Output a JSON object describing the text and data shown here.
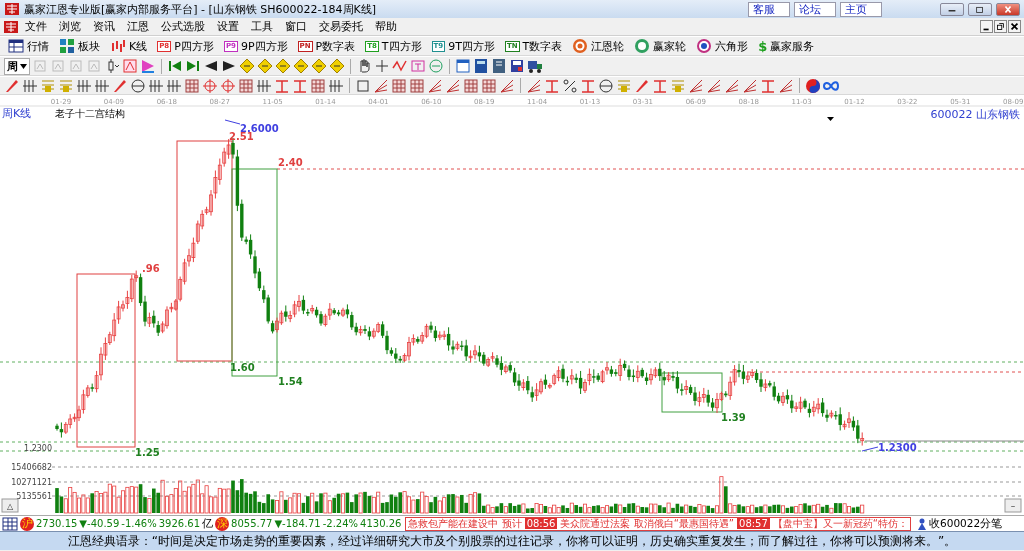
{
  "window": {
    "title": "赢家江恩专业版[赢家内部服务平台] - [山东钢铁  SH600022-184周K线]",
    "links": [
      "客服",
      "论坛",
      "主页"
    ]
  },
  "menu": [
    "文件",
    "浏览",
    "资讯",
    "江恩",
    "公式选股",
    "设置",
    "工具",
    "窗口",
    "交易委托",
    "帮助"
  ],
  "toolbar": [
    {
      "label": "行情",
      "kind": "table"
    },
    {
      "label": "板块",
      "kind": "blocks"
    },
    {
      "label": "K线",
      "kind": "kline"
    },
    {
      "label": "P四方形",
      "kind": "badge",
      "badge": "P8",
      "color": "#e03030"
    },
    {
      "label": "9P四方形",
      "kind": "badge",
      "badge": "P9",
      "color": "#c030c0"
    },
    {
      "label": "P数字表",
      "kind": "badge",
      "badge": "PN",
      "color": "#c02020"
    },
    {
      "label": "T四方形",
      "kind": "badge",
      "badge": "T8",
      "color": "#20a020"
    },
    {
      "label": "9T四方形",
      "kind": "badge",
      "badge": "T9",
      "color": "#209090"
    },
    {
      "label": "T数字表",
      "kind": "badge",
      "badge": "TN",
      "color": "#208020"
    },
    {
      "label": "江恩轮",
      "kind": "wheel"
    },
    {
      "label": "赢家轮",
      "kind": "wheel2"
    },
    {
      "label": "六角形",
      "kind": "hexagon"
    },
    {
      "label": "赢家服务",
      "kind": "glyph",
      "badge": "$"
    }
  ],
  "period_selector": {
    "value": "周"
  },
  "chart": {
    "period": "周K线",
    "indicator": "老子十二宫结构",
    "stock": "600022 山东钢铁",
    "dates": [
      "01-29",
      "04-09",
      "06-18",
      "08-27",
      "11-05",
      "01-14",
      "04-01",
      "06-10",
      "08-19",
      "11-04",
      "01-13",
      "03-31",
      "06-09",
      "08-18",
      "11-03",
      "01-12",
      "03-22",
      "05-31",
      "08-09"
    ],
    "price_labels": [
      {
        "text": "2.6000",
        "color": "#4040e0"
      },
      {
        "text": "2.51",
        "color": "#e04040"
      },
      {
        "text": "2.40",
        "color": "#e04040"
      },
      {
        "text": ".96",
        "color": "#e04040"
      },
      {
        "text": "1.60",
        "color": "#208020"
      },
      {
        "text": "1.54",
        "color": "#208020"
      },
      {
        "text": "1.39",
        "color": "#208020"
      },
      {
        "text": "1.25",
        "color": "#208020"
      },
      {
        "text": "1.2300",
        "color": "#4040e0"
      }
    ],
    "price_axis": "1.2300",
    "volume_axis": [
      "15406682",
      "10271121",
      "5135561"
    ],
    "collapse_button": "△",
    "expand_button": "–"
  },
  "status_bar": {
    "indices": [
      {
        "badge": "沪",
        "value": "2730.15",
        "change": "▼-40.59",
        "percent": "-1.46%",
        "amount": "3926.61",
        "unit": "亿"
      },
      {
        "badge": "深",
        "value": "8055.77",
        "change": "▼-184.71",
        "percent": "-2.24%",
        "amount": "4130.26"
      }
    ],
    "ticker": [
      {
        "kind": "headline",
        "text": "急救包产能在建设中 预计"
      },
      {
        "kind": "time",
        "text": "08:56"
      },
      {
        "kind": "headline",
        "text": "美众院通过法案 取消俄白“最惠国待遇”"
      },
      {
        "kind": "time",
        "text": "08:57"
      },
      {
        "kind": "headline",
        "text": "【盘中宝】又一新冠药“特仿："
      }
    ],
    "tick_link": "收600022分笔"
  },
  "quote_bar": "江恩经典语录：“时间是决定市场走势的重要因素，经过详细研究大市及个别股票的过往记录，你将可以证明，历史确实重复发生；而了解过往，你将可以预测将来。”。"
}
